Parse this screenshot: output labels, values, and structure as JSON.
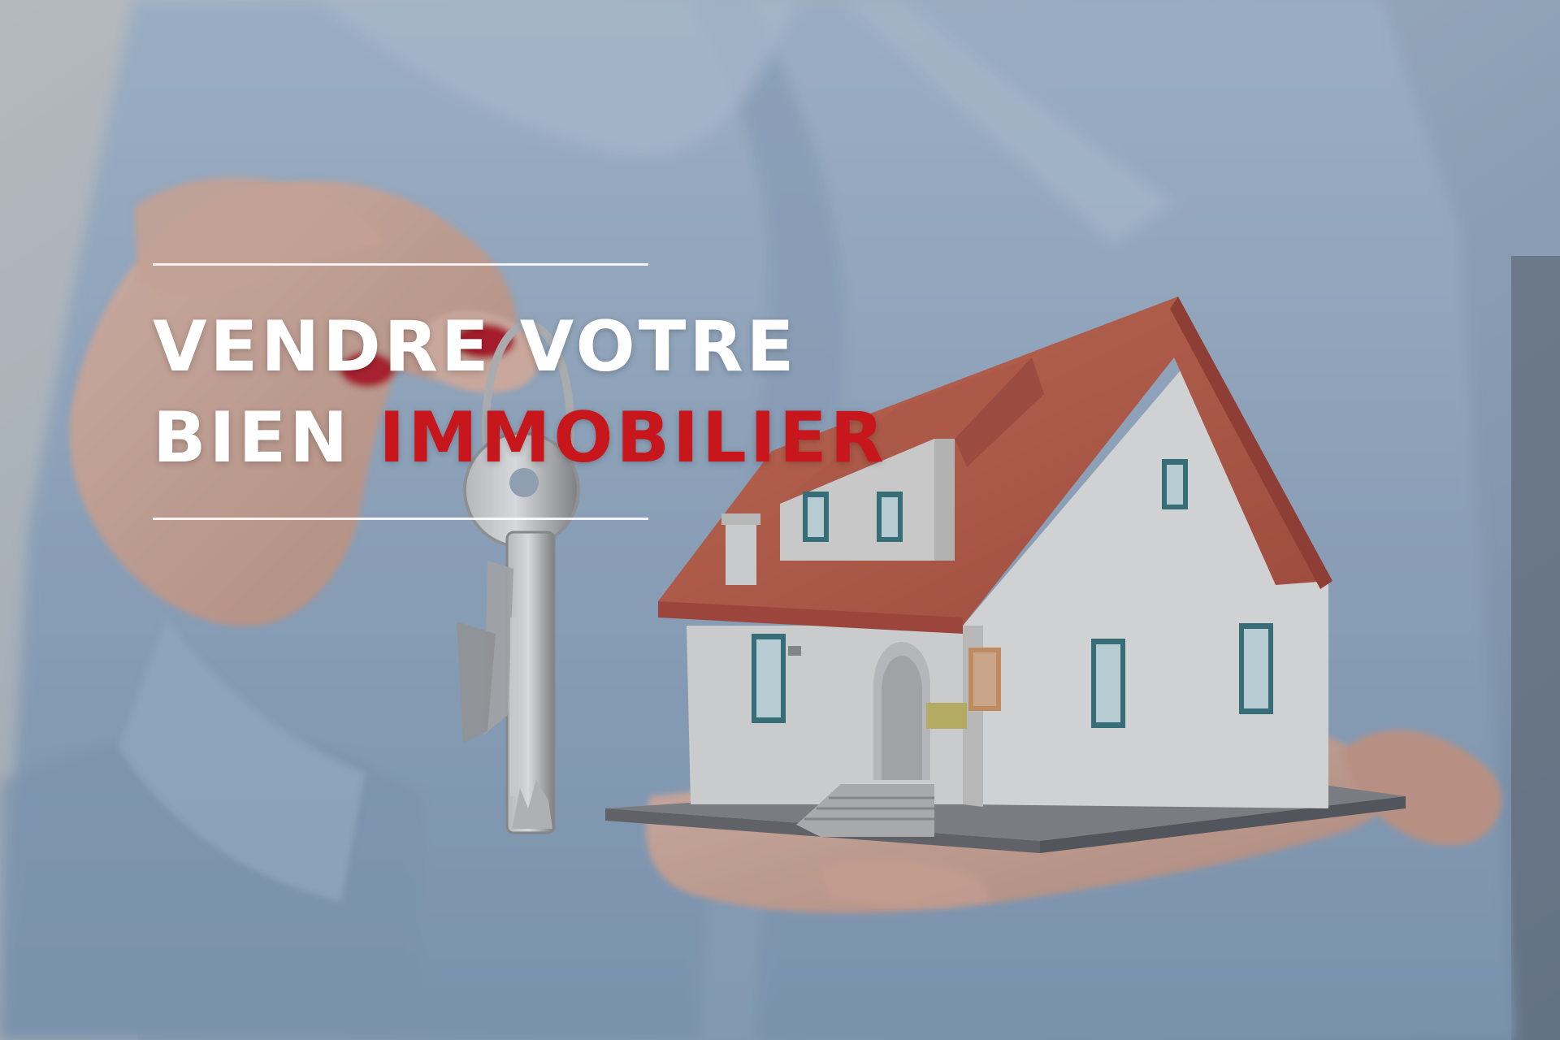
{
  "hero": {
    "line1": "VENDRE VOTRE",
    "line2_prefix": "BIEN",
    "line2_highlight": "IMMOBILIER"
  },
  "colors": {
    "accent": "#c8161d",
    "text": "#ffffff",
    "rule": "#ffffff",
    "shirt": "#a9c0da",
    "roof": "#d86a54",
    "house": "#f4f3f1"
  },
  "image": {
    "subject": "hand-holding-keys-and-model-house"
  }
}
